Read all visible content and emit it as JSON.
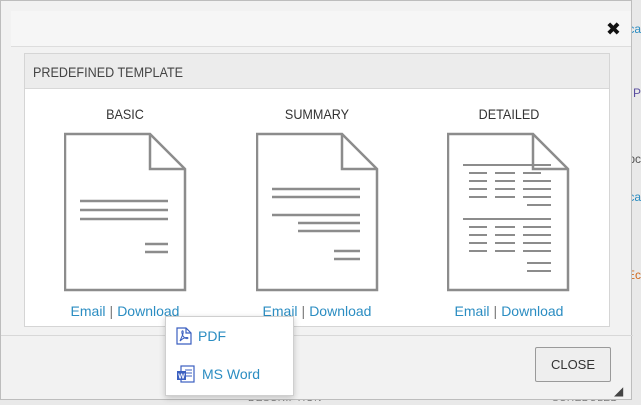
{
  "modal": {
    "section_title": "PREDEFINED TEMPLATE",
    "close_icon_glyph": "✖",
    "close_button_label": "CLOSE"
  },
  "templates": [
    {
      "title": "BASIC",
      "email_label": "Email",
      "separator": "|",
      "download_label": "Download"
    },
    {
      "title": "SUMMARY",
      "email_label": "Email",
      "separator": "|",
      "download_label": "Download"
    },
    {
      "title": "DETAILED",
      "email_label": "Email",
      "separator": "|",
      "download_label": "Download"
    }
  ],
  "download_menu": {
    "items": [
      {
        "label": "PDF",
        "icon": "pdf-icon"
      },
      {
        "label": "MS Word",
        "icon": "word-document-icon"
      }
    ]
  },
  "background": {
    "edge_fragments": [
      "ca",
      "P",
      "pc",
      "ca",
      "Ec"
    ],
    "bottom_fragments": [
      "DESCRIPTION",
      "SCHEDULED DAT"
    ]
  },
  "colors": {
    "link": "#2b8dc2",
    "icon_blue": "#3b5fc0"
  }
}
